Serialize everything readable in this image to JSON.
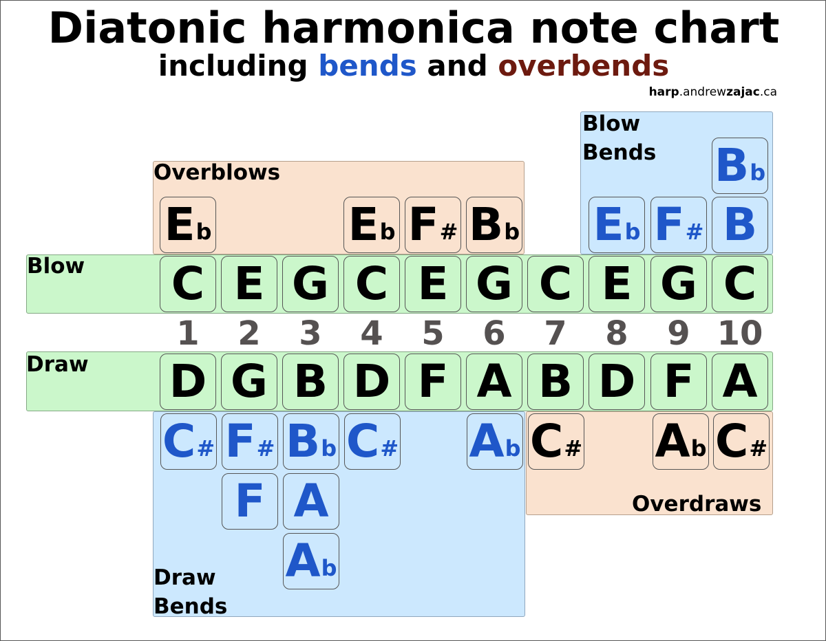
{
  "title": "Diatonic harmonica note chart",
  "subtitle": {
    "prefix": "including",
    "bends": "bends",
    "middle": "and",
    "overbends": "overbends"
  },
  "credit": {
    "bold1": "harp",
    "normal1": ".andrew",
    "bold2": "zajac",
    "normal2": ".ca"
  },
  "labels": {
    "overblows": "Overblows",
    "blow_bends": "Blow\nBends",
    "blow": "Blow",
    "draw": "Draw",
    "draw_bends": "Draw\nBends",
    "overdraws": "Overdraws"
  },
  "colors": {
    "blow_draw_rows": "#cbf7cb",
    "bends": "#cce8fe",
    "overbends": "#fae2cf",
    "bends_text": "#1f57c9",
    "overbends_text": "#6d1a0f",
    "hole_numbers": "#555151"
  },
  "holes": [
    "1",
    "2",
    "3",
    "4",
    "5",
    "6",
    "7",
    "8",
    "9",
    "10"
  ],
  "blow": [
    {
      "note": "C",
      "acc": ""
    },
    {
      "note": "E",
      "acc": ""
    },
    {
      "note": "G",
      "acc": ""
    },
    {
      "note": "C",
      "acc": ""
    },
    {
      "note": "E",
      "acc": ""
    },
    {
      "note": "G",
      "acc": ""
    },
    {
      "note": "C",
      "acc": ""
    },
    {
      "note": "E",
      "acc": ""
    },
    {
      "note": "G",
      "acc": ""
    },
    {
      "note": "C",
      "acc": ""
    }
  ],
  "draw": [
    {
      "note": "D",
      "acc": ""
    },
    {
      "note": "G",
      "acc": ""
    },
    {
      "note": "B",
      "acc": ""
    },
    {
      "note": "D",
      "acc": ""
    },
    {
      "note": "F",
      "acc": ""
    },
    {
      "note": "A",
      "acc": ""
    },
    {
      "note": "B",
      "acc": ""
    },
    {
      "note": "D",
      "acc": ""
    },
    {
      "note": "F",
      "acc": ""
    },
    {
      "note": "A",
      "acc": ""
    }
  ],
  "overblows": [
    {
      "hole": "1",
      "note": "E",
      "acc": "b"
    },
    {
      "hole": "4",
      "note": "E",
      "acc": "b"
    },
    {
      "hole": "5",
      "note": "F",
      "acc": "#"
    },
    {
      "hole": "6",
      "note": "B",
      "acc": "b"
    }
  ],
  "blow_bends": [
    {
      "hole": "8",
      "note": "E",
      "acc": "b"
    },
    {
      "hole": "9",
      "note": "F",
      "acc": "#"
    },
    {
      "hole": "10",
      "note": "B",
      "acc": ""
    },
    {
      "hole": "10",
      "note": "B",
      "acc": "b"
    }
  ],
  "draw_bends": [
    {
      "hole": "1",
      "note": "C",
      "acc": "#"
    },
    {
      "hole": "2",
      "note": "F",
      "acc": "#"
    },
    {
      "hole": "2",
      "note": "F",
      "acc": ""
    },
    {
      "hole": "3",
      "note": "B",
      "acc": "b"
    },
    {
      "hole": "3",
      "note": "A",
      "acc": ""
    },
    {
      "hole": "3",
      "note": "A",
      "acc": "b"
    },
    {
      "hole": "4",
      "note": "C",
      "acc": "#"
    },
    {
      "hole": "6",
      "note": "A",
      "acc": "b"
    }
  ],
  "overdraws": [
    {
      "hole": "7",
      "note": "C",
      "acc": "#"
    },
    {
      "hole": "9",
      "note": "A",
      "acc": "b"
    },
    {
      "hole": "10",
      "note": "C",
      "acc": "#"
    }
  ]
}
